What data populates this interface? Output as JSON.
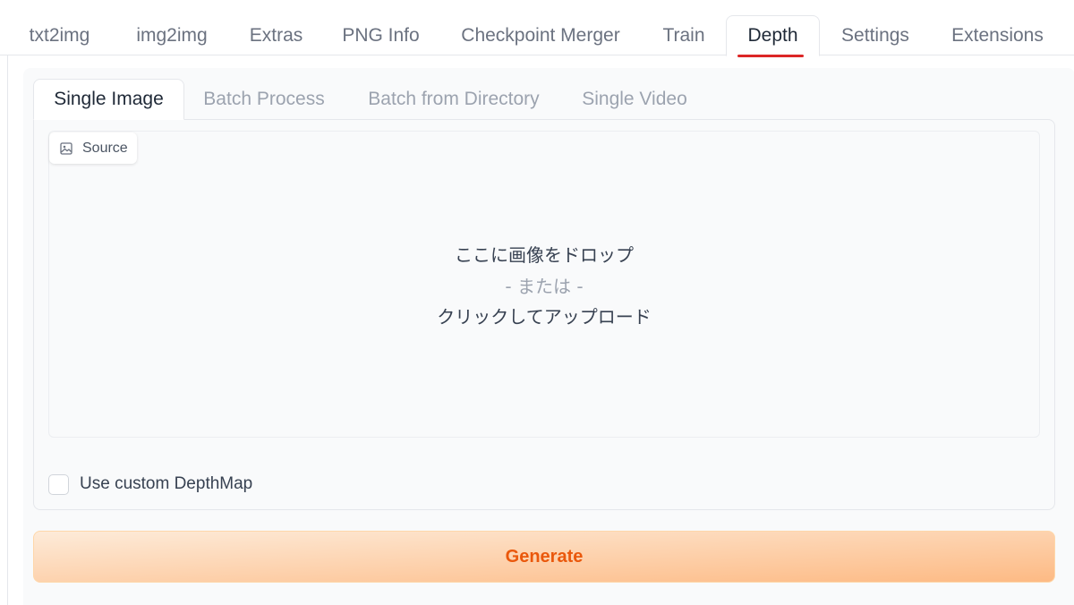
{
  "top_tabs": [
    {
      "label": "txt2img"
    },
    {
      "label": "img2img"
    },
    {
      "label": "Extras"
    },
    {
      "label": "PNG Info"
    },
    {
      "label": "Checkpoint Merger"
    },
    {
      "label": "Train"
    },
    {
      "label": "Depth",
      "active": true
    },
    {
      "label": "Settings"
    },
    {
      "label": "Extensions"
    }
  ],
  "sub_tabs": [
    {
      "label": "Single Image",
      "active": true
    },
    {
      "label": "Batch Process"
    },
    {
      "label": "Batch from Directory"
    },
    {
      "label": "Single Video"
    }
  ],
  "source": {
    "label": "Source",
    "icon": "image-icon",
    "drop_line1": "ここに画像をドロップ",
    "drop_or": "- または -",
    "drop_line2": "クリックしてアップロード"
  },
  "custom_depthmap": {
    "label": "Use custom DepthMap",
    "checked": false
  },
  "generate": {
    "label": "Generate"
  },
  "colors": {
    "active_underline": "#dc2626",
    "generate_text": "#ea580c",
    "generate_bg_start": "#fdebd9",
    "generate_bg_end": "#fdba84"
  }
}
